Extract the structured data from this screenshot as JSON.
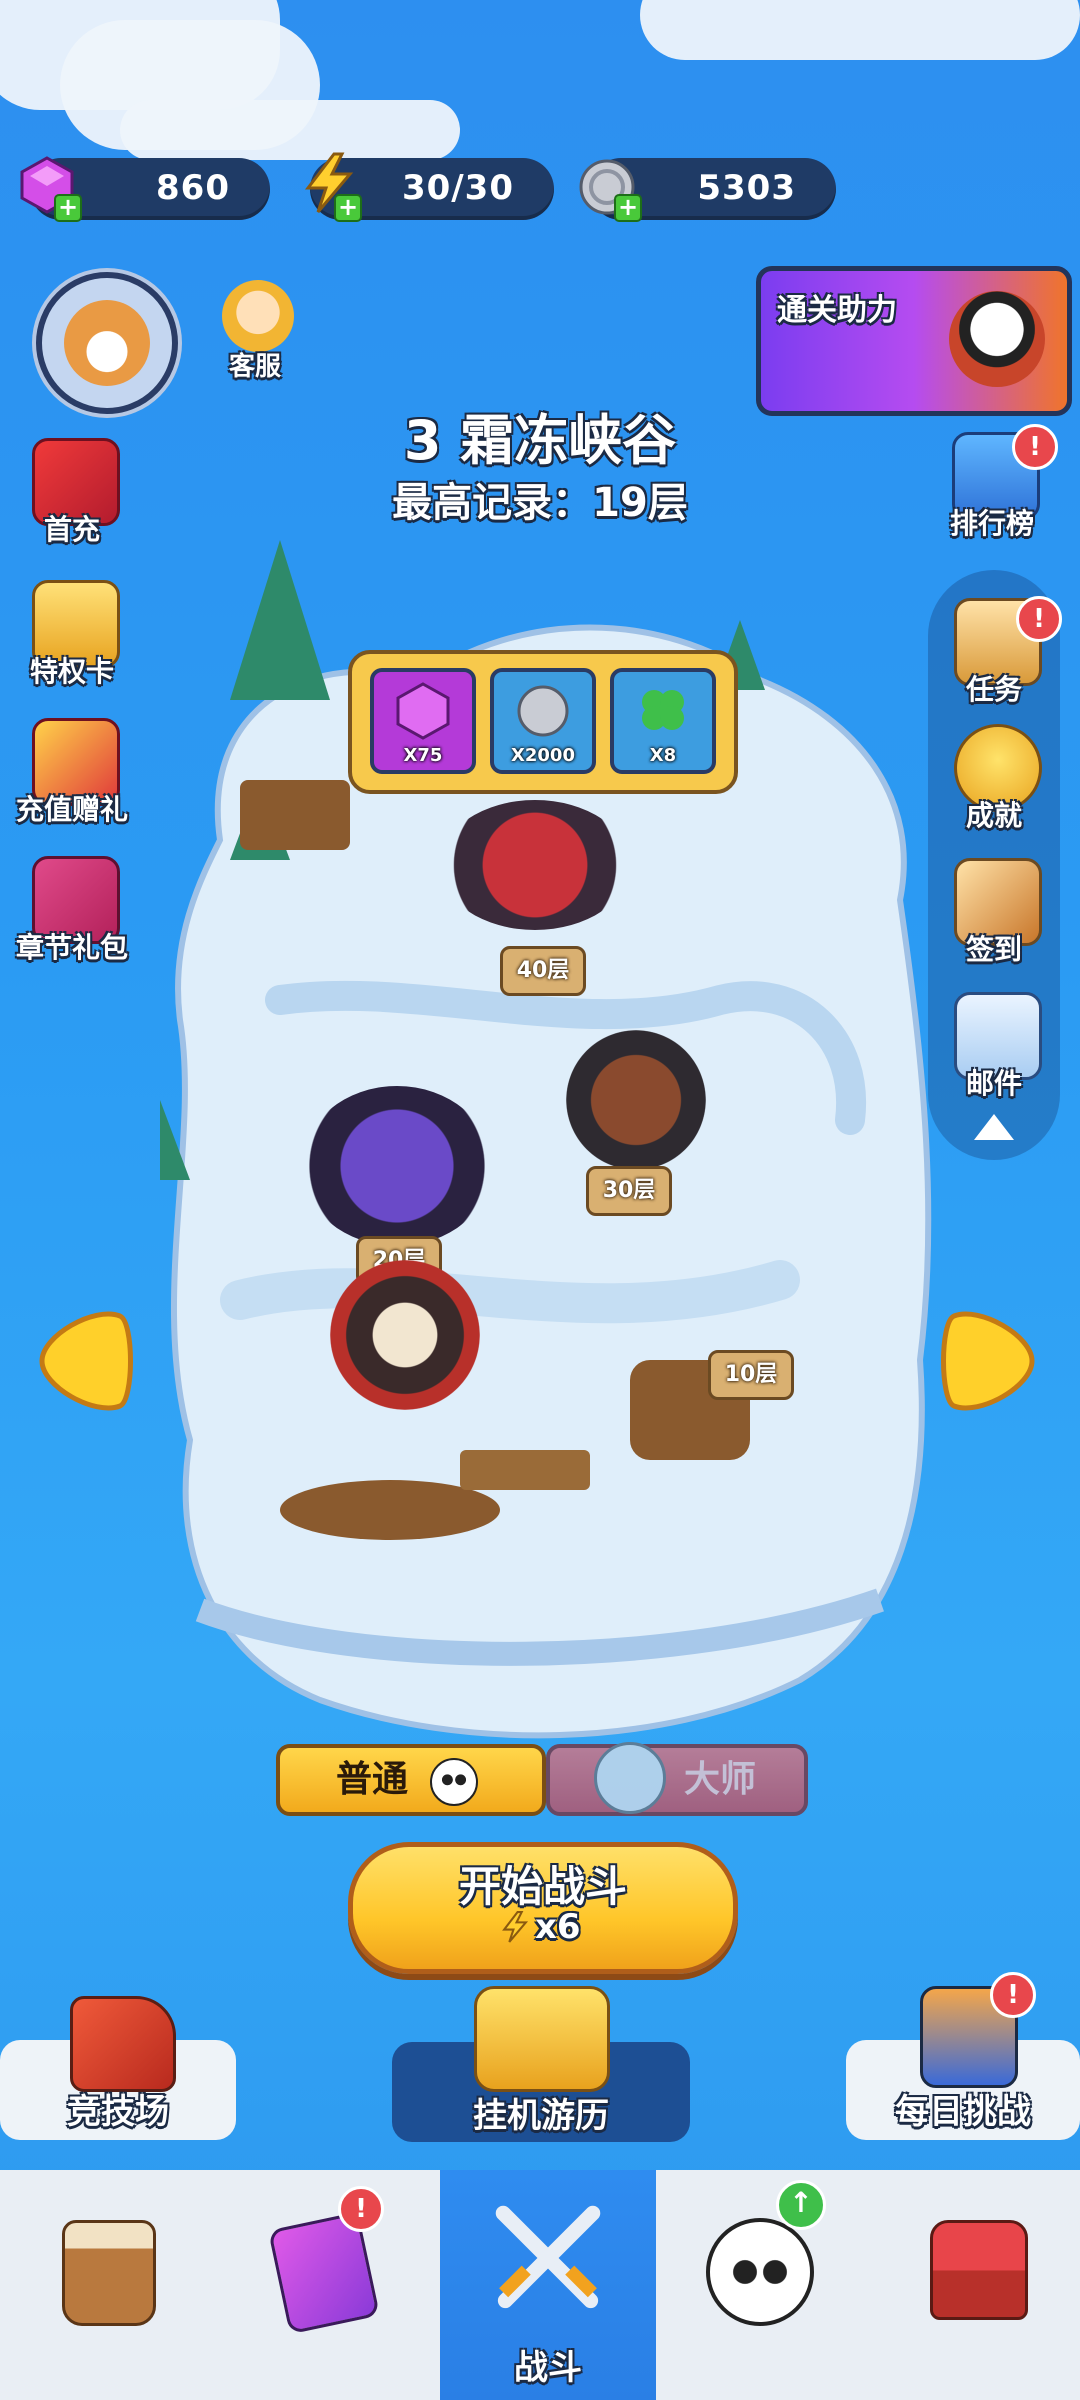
{
  "resources": {
    "gems": "860",
    "energy": "30/30",
    "coins": "5303"
  },
  "header": {
    "customer_service": "客服",
    "promo_banner": "通关助力"
  },
  "stage": {
    "title": "3 霜冻峡谷",
    "best_record": "最高记录：19层"
  },
  "left_menu": {
    "first_recharge": "首充",
    "privilege_card": "特权卡",
    "recharge_gift": "充值赠礼",
    "chapter_pack": "章节礼包"
  },
  "right_menu": {
    "leaderboard": "排行榜",
    "tasks": "任务",
    "achievements": "成就",
    "sign_in": "签到",
    "mail": "邮件"
  },
  "rewards": [
    {
      "icon": "gem-icon",
      "qty": "X75"
    },
    {
      "icon": "coin-icon",
      "qty": "X2000"
    },
    {
      "icon": "clover-icon",
      "qty": "X8"
    }
  ],
  "floors": {
    "f40": "40层",
    "f30": "30层",
    "f20": "20层",
    "f10": "10层"
  },
  "difficulty": {
    "normal": "普通",
    "master": "大师"
  },
  "start": {
    "label": "开始战斗",
    "cost": "x6"
  },
  "modes": {
    "arena": "竞技场",
    "idle": "挂机游历",
    "daily": "每日挑战"
  },
  "bottom_nav": {
    "battle": "战斗"
  },
  "colors": {
    "bg": "#2b9bf3",
    "accent_yellow": "#ffc629",
    "badge_red": "#e8474c",
    "pill_dark": "#1f3b66"
  }
}
